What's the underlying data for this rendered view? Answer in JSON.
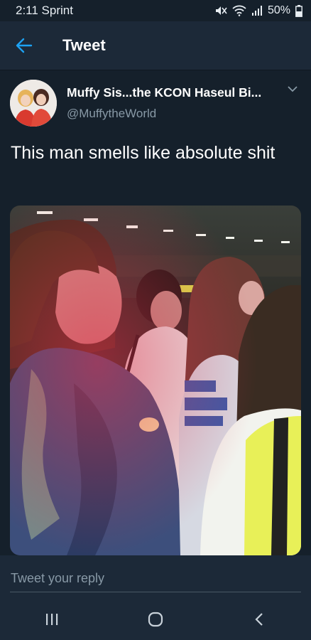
{
  "status": {
    "carrier_time": "2:11 Sprint",
    "battery": "50%",
    "icons": [
      "mute-icon",
      "wifi-icon",
      "signal-icon",
      "battery-icon"
    ]
  },
  "appbar": {
    "title": "Tweet",
    "back_icon": "back-arrow-icon",
    "accent": "#1da1f2"
  },
  "tweet": {
    "display_name": "Muffy Sis...the KCON Haseul Bi...",
    "handle": "@MuffytheWorld",
    "text": "This man smells like absolute shit",
    "media": "concert-crowd-photo"
  },
  "reply": {
    "placeholder": "Tweet your reply"
  },
  "navbar": {
    "buttons": [
      "recent-apps-icon",
      "home-icon",
      "back-icon"
    ]
  },
  "colors": {
    "background": "#15202b",
    "bar": "#1c2938",
    "muted_text": "#8899a6"
  }
}
